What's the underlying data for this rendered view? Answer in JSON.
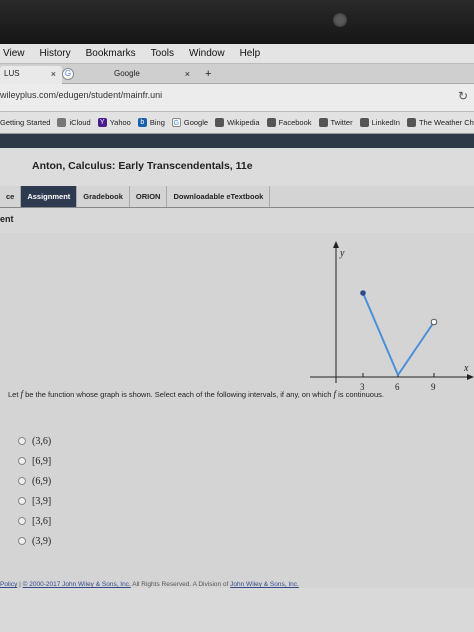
{
  "menubar": [
    "View",
    "History",
    "Bookmarks",
    "Tools",
    "Window",
    "Help"
  ],
  "tabs": {
    "active_label": "LUS",
    "second_label": "Google",
    "close": "×",
    "plus": "+"
  },
  "url": "wileyplus.com/edugen/student/mainfr.uni",
  "bookmarks": [
    "Getting Started",
    "iCloud",
    "Yahoo",
    "Bing",
    "Google",
    "Wikipedia",
    "Facebook",
    "Twitter",
    "LinkedIn",
    "The Weather Chann"
  ],
  "course": {
    "title": "Anton, Calculus: Early Transcendentals, 11e"
  },
  "navtabs": [
    "ce",
    "Assignment",
    "Gradebook",
    "ORION",
    "Downloadable eTextbook"
  ],
  "subheader": "ent",
  "graph": {
    "y_label": "y",
    "x_label": "x",
    "ticks": [
      "3",
      "6",
      "9"
    ]
  },
  "question": {
    "pre": "Let ",
    "f1": "f",
    "mid": " be the function whose graph is shown. Select each of the following intervals, if any, on which ",
    "f2": "f",
    "post": " is continuous."
  },
  "options": [
    "(3,6)",
    "[6,9]",
    "(6,9)",
    "[3,9]",
    "[3,6]",
    "(3,9)"
  ],
  "footer": {
    "policy": "Policy",
    "sep": " | ",
    "copyright": "© 2000-2017 John Wiley & Sons, Inc.",
    "mid": " All Rights Reserved. A Division of ",
    "company": "John Wiley & Sons, Inc."
  }
}
